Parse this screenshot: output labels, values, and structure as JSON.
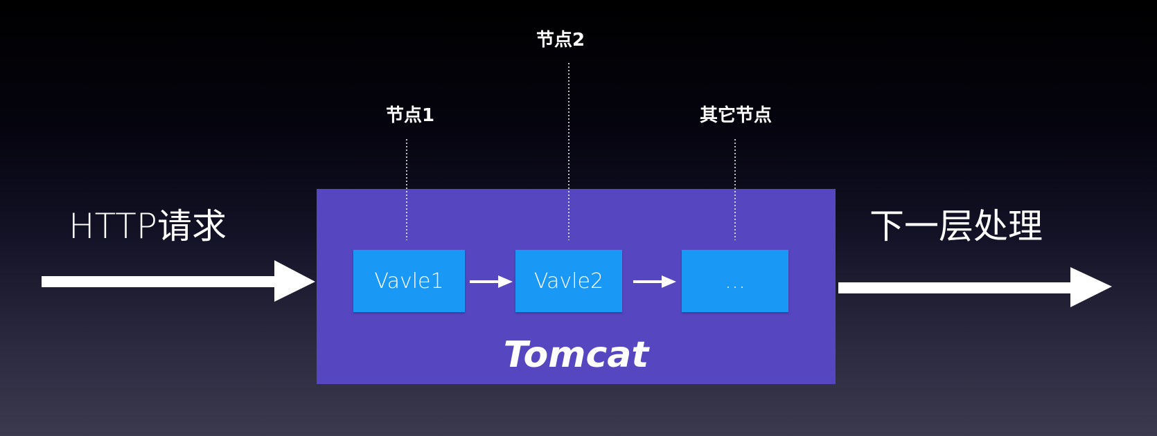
{
  "diagram": {
    "input_label": "HTTP请求",
    "output_label": "下一层处理",
    "container_label": "Tomcat",
    "valves": [
      {
        "label": "Vavle1"
      },
      {
        "label": "Vavle2"
      },
      {
        "label": "…"
      }
    ],
    "nodes": [
      {
        "label": "节点1"
      },
      {
        "label": "节点2"
      },
      {
        "label": "其它节点"
      }
    ],
    "colors": {
      "container": "#5647c1",
      "valve": "#1a98f5",
      "arrows": "#ffffff"
    }
  }
}
